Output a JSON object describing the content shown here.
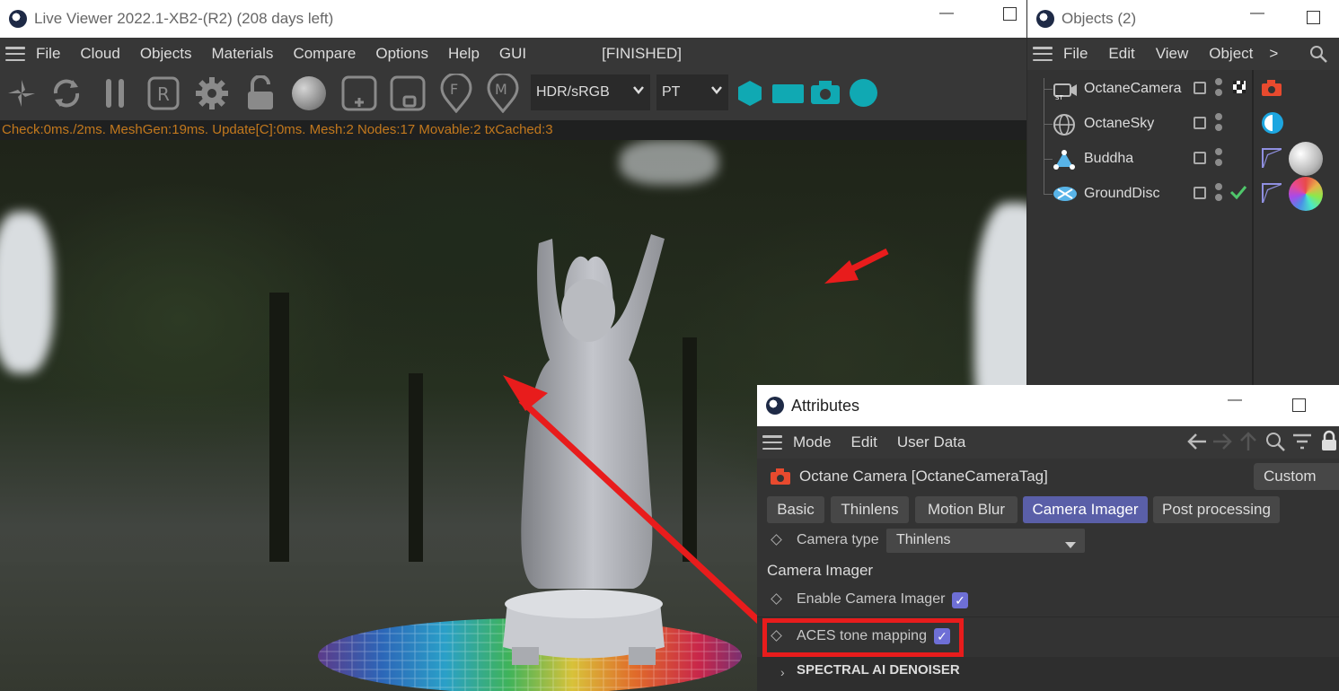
{
  "viewer": {
    "title": "Live Viewer 2022.1-XB2-(R2) (208 days left)",
    "menu": [
      "File",
      "Cloud",
      "Objects",
      "Materials",
      "Compare",
      "Options",
      "Help",
      "GUI"
    ],
    "render_state": "[FINISHED]",
    "color_space": "HDR/sRGB",
    "kernel": "PT",
    "status": "Check:0ms./2ms. MeshGen:19ms. Update[C]:0ms. Mesh:2 Nodes:17 Movable:2 txCached:3",
    "toolbar_icons": [
      "send-scene-icon",
      "restart-icon",
      "pause-icon",
      "region-render-icon",
      "settings-gear-icon",
      "lock-icon",
      "material-ball-icon",
      "add-region-icon",
      "clay-mode-icon",
      "focus-pick-icon",
      "material-pick-icon"
    ],
    "teal_icons": [
      "hexagon-icon",
      "rectangle-icon",
      "camera-icon",
      "circle-icon"
    ],
    "accent_color": "#10a9b3"
  },
  "objects": {
    "title": "Objects (2)",
    "menu": [
      "File",
      "Edit",
      "View",
      "Object"
    ],
    "more": ">",
    "items": [
      {
        "name": "OctaneCamera",
        "icon": "camera-object-icon"
      },
      {
        "name": "OctaneSky",
        "icon": "sky-object-icon"
      },
      {
        "name": "Buddha",
        "icon": "mesh-object-icon"
      },
      {
        "name": "GroundDisc",
        "icon": "disc-object-icon"
      }
    ]
  },
  "attributes": {
    "title": "Attributes",
    "menu": [
      "Mode",
      "Edit",
      "User Data"
    ],
    "object_label": "Octane Camera [OctaneCameraTag]",
    "preset": "Custom",
    "tabs": [
      "Basic",
      "Thinlens",
      "Motion Blur",
      "Camera Imager",
      "Post processing"
    ],
    "active_tab": "Camera Imager",
    "camera_type_label": "Camera type",
    "camera_type_value": "Thinlens",
    "section_title": "Camera Imager",
    "enable_label": "Enable Camera Imager",
    "enable_checked": true,
    "aces_label": "ACES tone mapping",
    "aces_checked": true,
    "denoiser_section": "SPECTRAL AI DENOISER"
  },
  "annotation_color": "#e81c1c"
}
